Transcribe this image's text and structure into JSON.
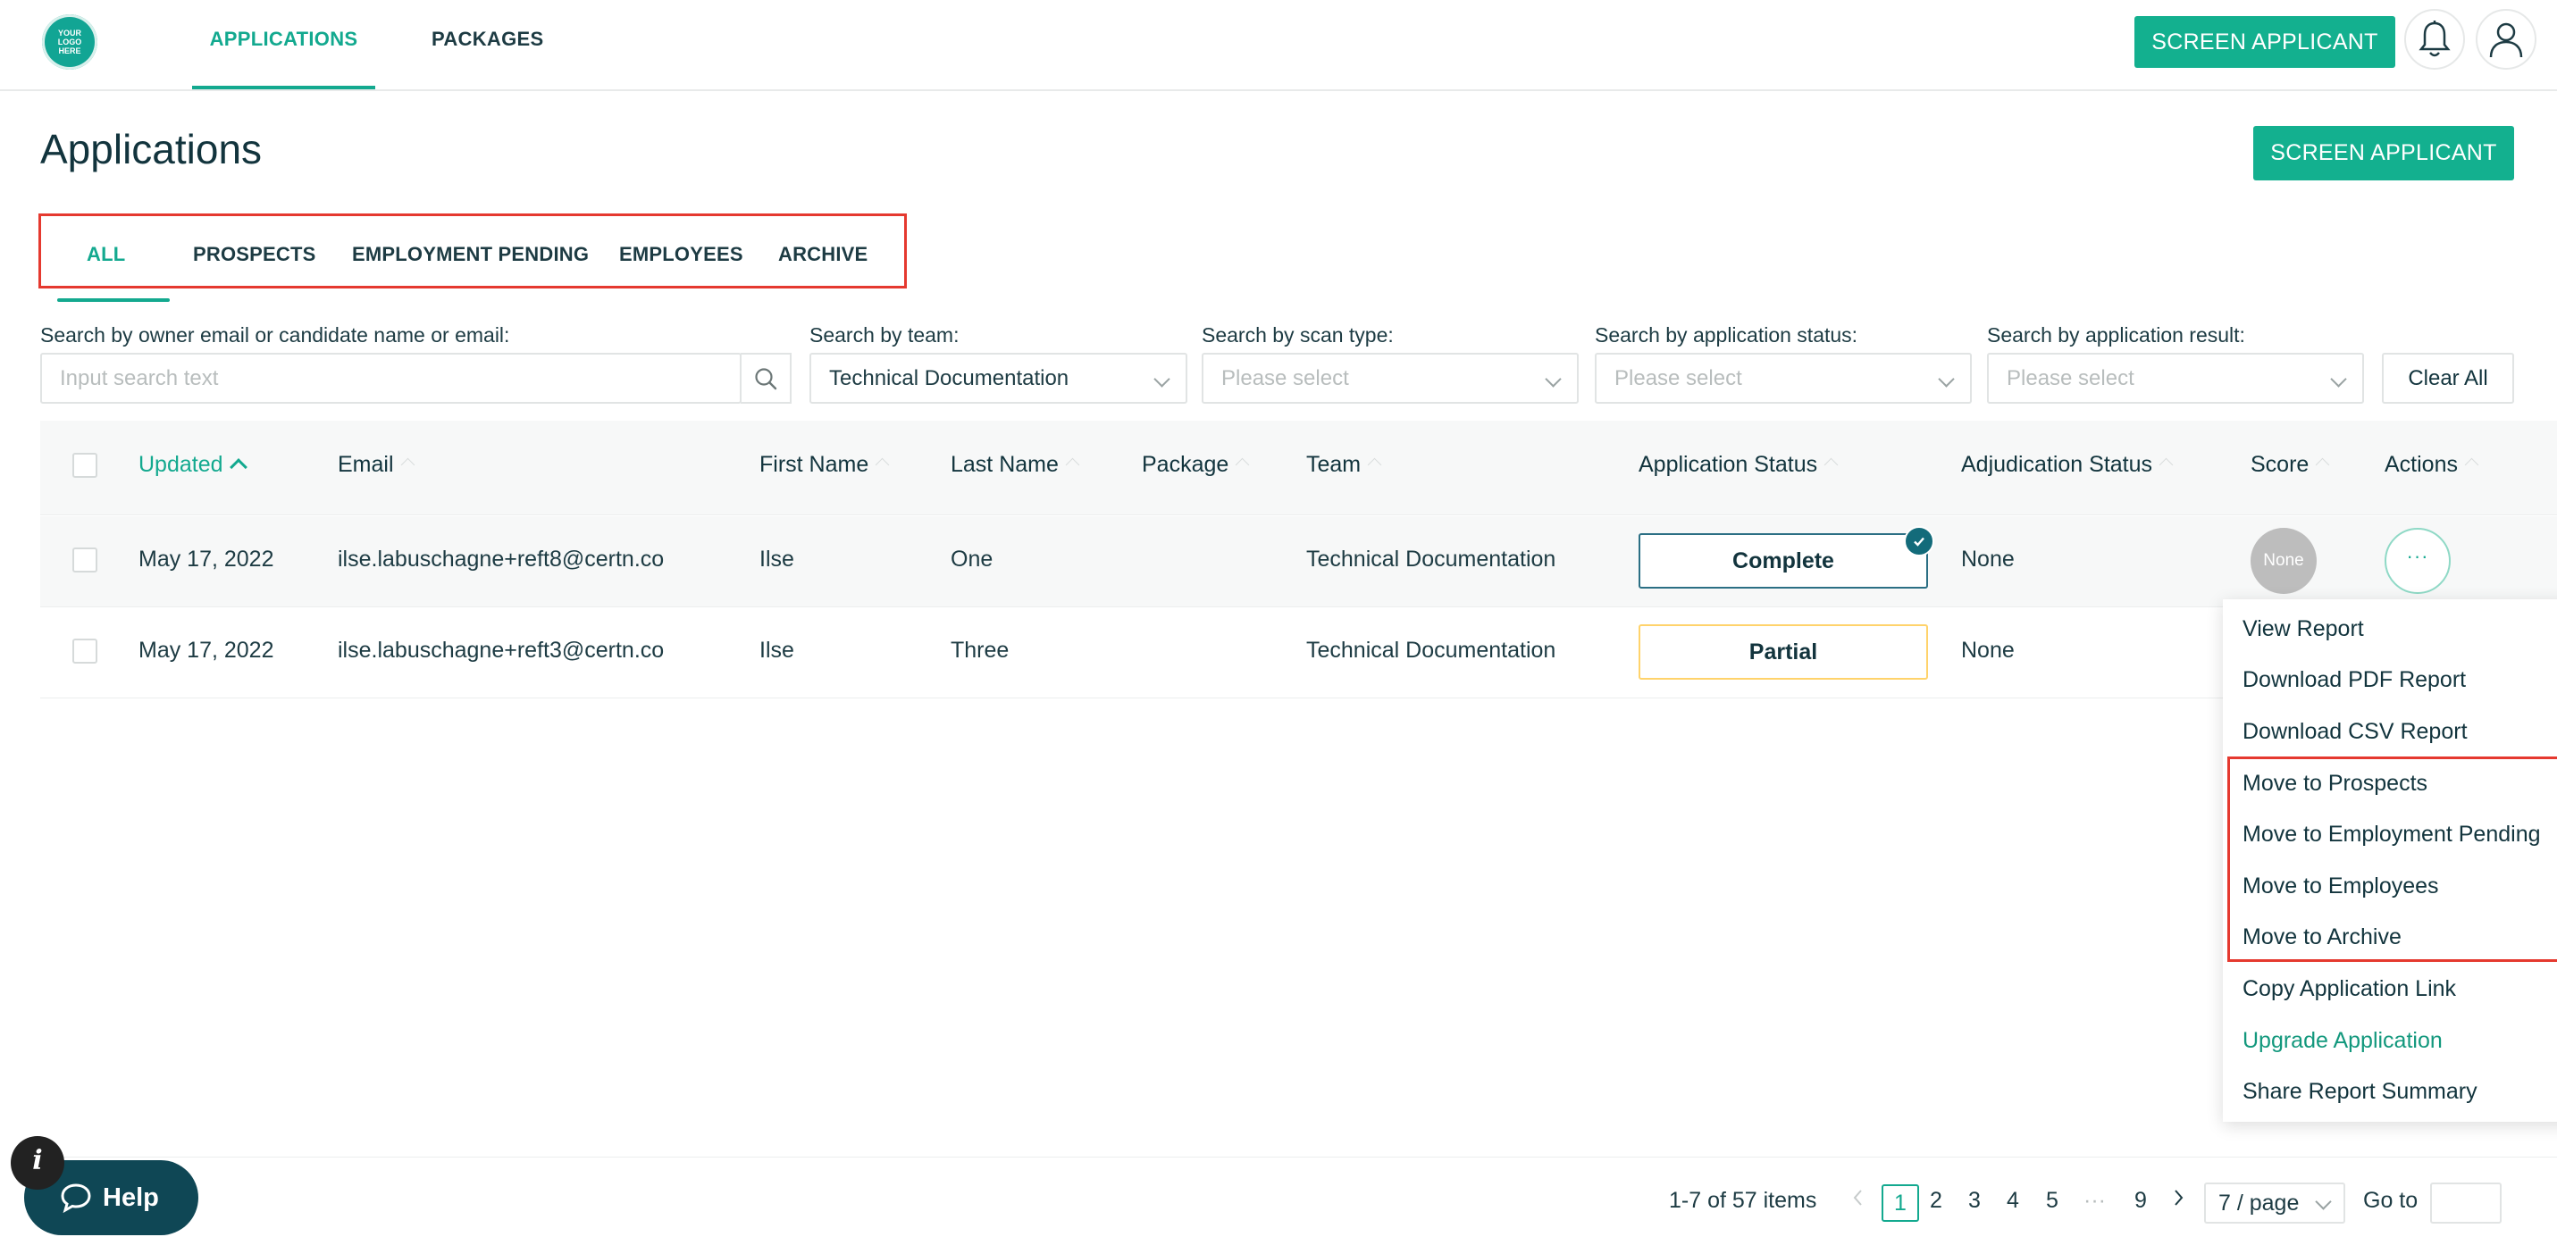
{
  "brand": {
    "logo_text": "YOUR LOGO HERE",
    "accent": "#13a98f"
  },
  "nav": {
    "tabs": [
      {
        "label": "APPLICATIONS",
        "active": true
      },
      {
        "label": "PACKAGES",
        "active": false
      }
    ],
    "screen_button": "SCREEN APPLICANT",
    "icons": [
      "bell-icon",
      "user-icon"
    ]
  },
  "page": {
    "title": "Applications",
    "screen_button": "SCREEN APPLICANT"
  },
  "subtabs": [
    {
      "label": "ALL",
      "active": true
    },
    {
      "label": "PROSPECTS"
    },
    {
      "label": "EMPLOYMENT PENDING"
    },
    {
      "label": "EMPLOYEES"
    },
    {
      "label": "ARCHIVE"
    }
  ],
  "filters": {
    "search": {
      "label": "Search by owner email or candidate name or email:",
      "placeholder": "Input search text"
    },
    "team": {
      "label": "Search by team:",
      "value": "Technical Documentation"
    },
    "scan_type": {
      "label": "Search by scan type:",
      "placeholder": "Please select"
    },
    "app_status": {
      "label": "Search by application status:",
      "placeholder": "Please select"
    },
    "app_result": {
      "label": "Search by application result:",
      "placeholder": "Please select"
    },
    "clear_all": "Clear All"
  },
  "table": {
    "columns": [
      "Updated",
      "Email",
      "First Name",
      "Last Name",
      "Package",
      "Team",
      "Application Status",
      "Adjudication Status",
      "Score",
      "Actions"
    ],
    "rows": [
      {
        "updated": "May 17, 2022",
        "email": "ilse.labuschagne+reft8@certn.co",
        "first": "Ilse",
        "last": "One",
        "package": "",
        "team": "Technical Documentation",
        "status": "Complete",
        "adjudication": "None",
        "score": "None",
        "actions": "···"
      },
      {
        "updated": "May 17, 2022",
        "email": "ilse.labuschagne+reft3@certn.co",
        "first": "Ilse",
        "last": "Three",
        "package": "",
        "team": "Technical Documentation",
        "status": "Partial",
        "adjudication": "None"
      }
    ]
  },
  "menu": {
    "items": [
      "View Report",
      "Download PDF Report",
      "Download CSV Report",
      "Move to Prospects",
      "Move to Employment Pending",
      "Move to Employees",
      "Move to Archive",
      "Copy Application Link",
      "Upgrade Application",
      "Share Report Summary"
    ]
  },
  "pagination": {
    "summary": "1-7 of 57 items",
    "pages": [
      "1",
      "2",
      "3",
      "4",
      "5",
      "9"
    ],
    "ellipsis": "···",
    "page_size": "7 / page",
    "goto": "Go to"
  },
  "help": {
    "label": "Help",
    "info": "i"
  }
}
